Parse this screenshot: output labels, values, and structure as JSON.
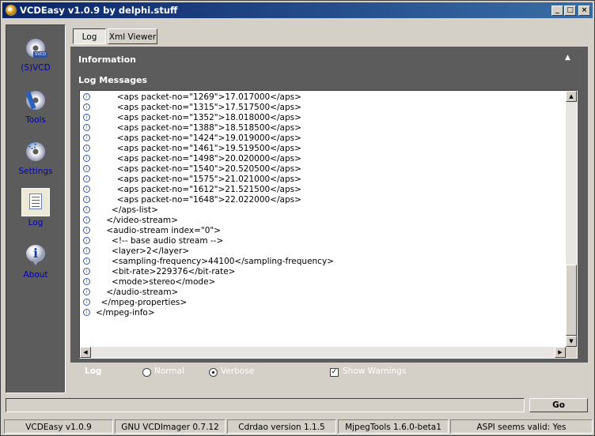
{
  "window": {
    "title": "VCDEasy v1.0.9 by delphi.stuff",
    "controls": {
      "minimize": "_",
      "maximize": "□",
      "close": "×"
    }
  },
  "sidebar": {
    "items": [
      {
        "label": "(S)VCD",
        "icon": "cd-disc-icon"
      },
      {
        "label": "Tools",
        "icon": "tools-disc-icon"
      },
      {
        "label": "Settings",
        "icon": "settings-disc-icon"
      },
      {
        "label": "Log",
        "icon": "log-document-icon"
      },
      {
        "label": "About",
        "icon": "info-icon"
      }
    ],
    "active": "Log"
  },
  "tabs": [
    {
      "label": "Log",
      "active": true
    },
    {
      "label": "Xml Viewer",
      "active": false
    }
  ],
  "panel": {
    "information_title": "Information",
    "log_messages_title": "Log Messages"
  },
  "log_lines": [
    "        <aps packet-no=\"1269\">17.017000</aps>",
    "        <aps packet-no=\"1315\">17.517500</aps>",
    "        <aps packet-no=\"1352\">18.018000</aps>",
    "        <aps packet-no=\"1388\">18.518500</aps>",
    "        <aps packet-no=\"1424\">19.019000</aps>",
    "        <aps packet-no=\"1461\">19.519500</aps>",
    "        <aps packet-no=\"1498\">20.020000</aps>",
    "        <aps packet-no=\"1540\">20.520500</aps>",
    "        <aps packet-no=\"1575\">21.021000</aps>",
    "        <aps packet-no=\"1612\">21.521500</aps>",
    "        <aps packet-no=\"1648\">22.022000</aps>",
    "      </aps-list>",
    "    </video-stream>",
    "    <audio-stream index=\"0\">",
    "      <!-- base audio stream -->",
    "      <layer>2</layer>",
    "      <sampling-frequency>44100</sampling-frequency>",
    "      <bit-rate>229376</bit-rate>",
    "      <mode>stereo</mode>",
    "    </audio-stream>",
    "  </mpeg-properties>",
    "</mpeg-info>"
  ],
  "log_options": {
    "label": "Log",
    "normal_label": "Normal",
    "verbose_label": "Verbose",
    "selected": "Verbose",
    "show_warnings_label": "Show Warnings",
    "show_warnings_checked": true
  },
  "go_button": "Go",
  "status_bar": [
    "VCDEasy v1.0.9",
    "GNU VCDImager 0.7.12",
    "Cdrdao version 1.1.5",
    "MjpegTools 1.6.0-beta1",
    "ASPI seems valid: Yes"
  ],
  "colors": {
    "titlebar_start": "#0a246a",
    "titlebar_end": "#3a6ea5",
    "panel_bg": "#5c5c5c",
    "nav_label": "#0000b0"
  }
}
